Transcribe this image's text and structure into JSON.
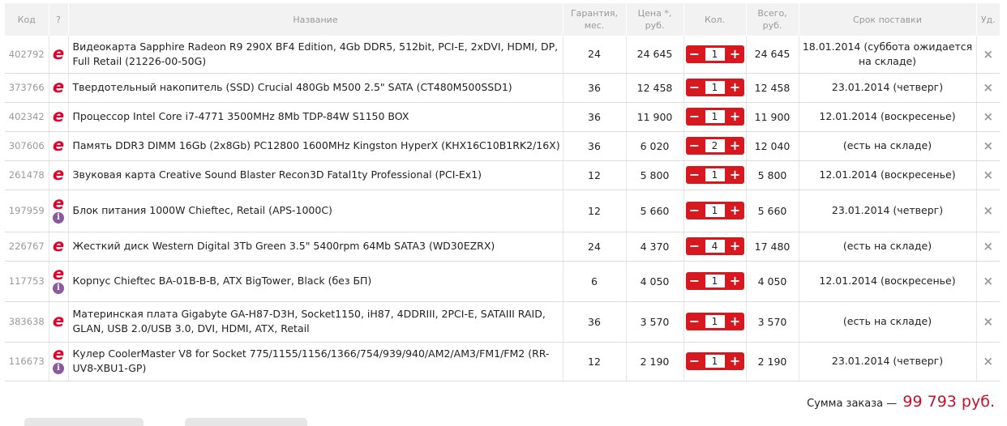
{
  "headers": {
    "code": "Код",
    "q": "?",
    "name": "Название",
    "warranty": "Гарантия, мес.",
    "price": "Цена *, руб.",
    "qty": "Кол.",
    "total": "Всего, руб.",
    "delivery": "Срок поставки",
    "del": "Уд."
  },
  "rows": [
    {
      "code": "402792",
      "info": false,
      "name": "Видеокарта Sapphire Radeon R9 290X BF4 Edition, 4Gb DDR5, 512bit, PCI-E, 2xDVI, HDMI, DP, Full Retail (21226-00-50G)",
      "warranty": "24",
      "price": "24 645",
      "qty": "1",
      "total": "24 645",
      "delivery": "18.01.2014 (суббота ожидается на складе)"
    },
    {
      "code": "373766",
      "info": false,
      "name": "Твердотельный накопитель (SSD) Crucial 480Gb M500 2.5\" SATA (CT480M500SSD1)",
      "warranty": "36",
      "price": "12 458",
      "qty": "1",
      "total": "12 458",
      "delivery": "23.01.2014 (четверг)"
    },
    {
      "code": "402342",
      "info": false,
      "name": "Процессор Intel Core i7-4771 3500MHz 8Mb TDP-84W S1150 BOX",
      "warranty": "36",
      "price": "11 900",
      "qty": "1",
      "total": "11 900",
      "delivery": "12.01.2014 (воскресенье)"
    },
    {
      "code": "307606",
      "info": false,
      "name": "Память DDR3 DIMM 16Gb (2x8Gb) PC12800 1600MHz Kingston HyperX (KHX16C10B1RK2/16X)",
      "warranty": "36",
      "price": "6 020",
      "qty": "2",
      "total": "12 040",
      "delivery": "(есть на складе)"
    },
    {
      "code": "261478",
      "info": false,
      "name": "Звуковая карта Creative Sound Blaster Recon3D Fatal1ty Professional (PCI-Ex1)",
      "warranty": "12",
      "price": "5 800",
      "qty": "1",
      "total": "5 800",
      "delivery": "12.01.2014 (воскресенье)"
    },
    {
      "code": "197959",
      "info": true,
      "name": "Блок питания 1000W Chieftec, Retail (APS-1000C)",
      "warranty": "12",
      "price": "5 660",
      "qty": "1",
      "total": "5 660",
      "delivery": "23.01.2014 (четверг)"
    },
    {
      "code": "226767",
      "info": false,
      "name": "Жесткий диск Western Digital 3Tb Green 3.5\" 5400rpm 64Mb SATA3 (WD30EZRX)",
      "warranty": "24",
      "price": "4 370",
      "qty": "4",
      "total": "17 480",
      "delivery": "(есть на складе)"
    },
    {
      "code": "117753",
      "info": true,
      "name": "Корпус Chieftec BA-01B-B-B, ATX BigTower, Black (без БП)",
      "warranty": "6",
      "price": "4 050",
      "qty": "1",
      "total": "4 050",
      "delivery": "12.01.2014 (воскресенье)"
    },
    {
      "code": "383638",
      "info": false,
      "name": "Материнская плата Gigabyte GA-H87-D3H, Socket1150, iH87, 4DDRIII, 2PCI-E, SATAIII RAID, GLAN, USB 2.0/USB 3.0, DVI, HDMI, ATX, Retail",
      "warranty": "36",
      "price": "3 570",
      "qty": "1",
      "total": "3 570",
      "delivery": "(есть на складе)"
    },
    {
      "code": "116673",
      "info": true,
      "name": "Кулер CoolerMaster V8 for Socket 775/1155/1156/1366/754/939/940/AM2/AM3/FM1/FM2 (RR-UV8-XBU1-GP)",
      "warranty": "12",
      "price": "2 190",
      "qty": "1",
      "total": "2 190",
      "delivery": "23.01.2014 (четверг)"
    }
  ],
  "icons": {
    "e": "e",
    "info": "i",
    "minus": "−",
    "plus": "+",
    "delete": "×"
  },
  "summary": {
    "label": "Сумма заказа —",
    "value": "99 793 руб."
  },
  "colors": {
    "accent": "#d7191f",
    "total": "#c8102e",
    "info": "#8a5aa0"
  }
}
